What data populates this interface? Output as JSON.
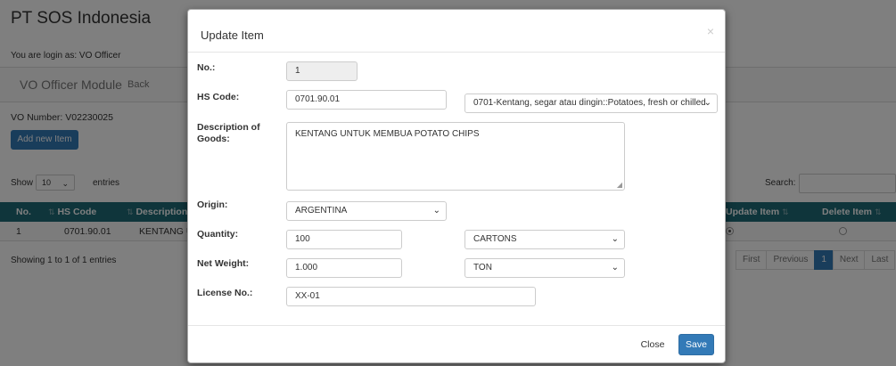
{
  "app": {
    "title": "PT SOS Indonesia",
    "login_text": "You are login as: VO Officer"
  },
  "navbar": {
    "brand": "VO Officer Module",
    "back_label": "Back"
  },
  "page": {
    "vo_number": "VO Number: V02230025",
    "add_button": "Add new Item"
  },
  "table_controls": {
    "show_label": "Show",
    "entries_value": "10",
    "entries_label": "entries",
    "search_label": "Search:"
  },
  "table": {
    "headers": [
      "No.",
      "HS Code",
      "Description",
      "Update Item",
      "Delete Item"
    ],
    "rows": [
      {
        "no": "1",
        "hs_code": "0701.90.01",
        "description": "KENTANG U",
        "update_selected": true,
        "delete_selected": false
      }
    ],
    "showing": "Showing 1 to 1 of 1 entries"
  },
  "pagination": {
    "first": "First",
    "previous": "Previous",
    "current": "1",
    "next": "Next",
    "last": "Last"
  },
  "modal": {
    "title": "Update Item",
    "close_symbol": "×",
    "labels": {
      "no": "No.:",
      "hs_code": "HS Code:",
      "description": "Description of Goods:",
      "origin": "Origin:",
      "quantity": "Quantity:",
      "net_weight": "Net Weight:",
      "license": "License No.:"
    },
    "values": {
      "no": "1",
      "hs_code": "0701.90.01",
      "hs_code_select": "0701-Kentang, segar atau dingin::Potatoes, fresh or chilled",
      "description": "KENTANG UNTUK MEMBUA POTATO CHIPS",
      "origin": "ARGENTINA",
      "quantity": "100",
      "quantity_unit": "CARTONS",
      "net_weight": "1.000",
      "weight_unit": "TON",
      "license": "XX-01"
    },
    "buttons": {
      "close": "Close",
      "save": "Save"
    }
  },
  "colors": {
    "table_header": "#1e6a77",
    "primary": "#337ab7",
    "overlay": "rgba(0,0,0,0.5)"
  },
  "icons": {
    "select_chevron": "chevron-down-icon",
    "sort": "sort-icon",
    "resize": "resize-grip-icon"
  }
}
